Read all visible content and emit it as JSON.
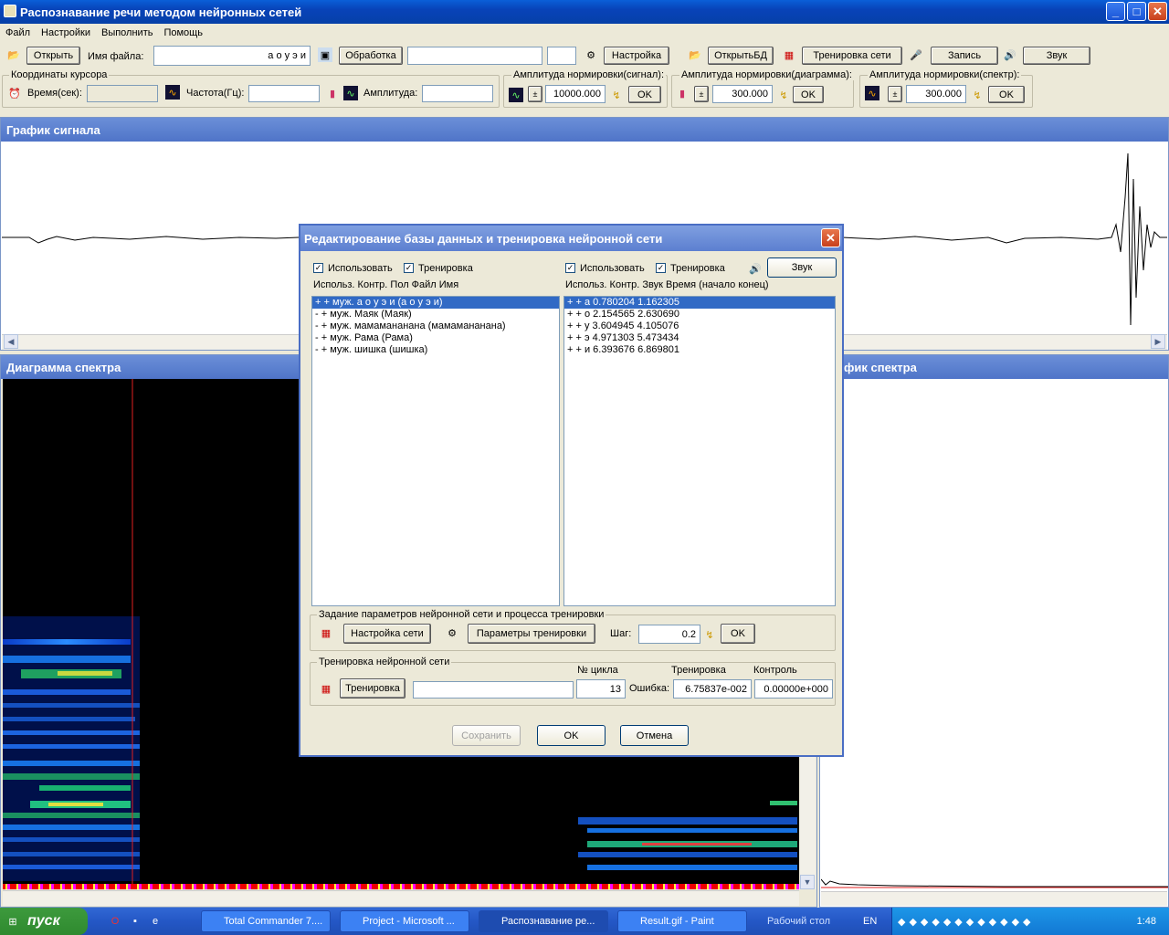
{
  "window": {
    "title": "Распознавание речи методом нейронных сетей"
  },
  "menu": [
    "Файл",
    "Настройки",
    "Выполнить",
    "Помощь"
  ],
  "toolbar": {
    "open": "Открыть",
    "filename_label": "Имя файла:",
    "filename_value": "а о у э и",
    "process": "Обработка",
    "settings": "Настройка",
    "open_db": "ОткрытьБД",
    "train_net": "Тренировка сети",
    "record": "Запись",
    "sound": "Звук"
  },
  "cursor": {
    "group": "Координаты курсора",
    "time_label": "Время(сек):",
    "freq_label": "Частота(Гц):",
    "amp_label": "Амплитуда:"
  },
  "amp_signal": {
    "group": "Амплитуда нормировки(сигнал):",
    "value": "10000.000",
    "ok": "OK"
  },
  "amp_diagram": {
    "group": "Амплитуда нормировки(диаграмма):",
    "value": "300.000",
    "ok": "OK"
  },
  "amp_spectrum": {
    "group": "Амплитуда нормировки(спектр):",
    "value": "300.000",
    "ok": "OK"
  },
  "panels": {
    "signal": "График сигнала",
    "diagram": "Диаграмма спектра",
    "spectrum": "График спектра",
    "spectrum_visible": "фик спектра"
  },
  "dialog": {
    "title": "Редактирование базы данных и тренировка нейронной сети",
    "use": "Использовать",
    "training": "Тренировка",
    "sound": "Звук",
    "left_header": "Использ. Контр. Пол Файл Имя",
    "right_header": "Использ. Контр. Звук Время (начало конец)",
    "left_items": [
      "+ + муж. а о у э и  (а о у э и)",
      "- + муж. Маяк  (Маяк)",
      "- + муж. мамамананана  (мамамананана)",
      "- + муж. Рама  (Рама)",
      "- + муж. шишка  (шишка)"
    ],
    "right_items": [
      "+ + а 0.780204 1.162305",
      "+ + о 2.154565 2.630690",
      "+ + у 3.604945 4.105076",
      "+ + э 4.971303 5.473434",
      "+ + и 6.393676 6.869801"
    ],
    "params_group": "Задание параметров нейронной сети и процесса тренировки",
    "net_settings": "Настройка сети",
    "train_params": "Параметры тренировки",
    "step_label": "Шаг:",
    "step_value": "0.2",
    "ok": "OK",
    "train_group": "Тренировка нейронной сети",
    "cycle_label": "№ цикла",
    "train_col": "Тренировка",
    "control_col": "Контроль",
    "train_btn": "Тренировка",
    "cycle_value": "13",
    "error_label": "Ошибка:",
    "train_error": "6.75837e-002",
    "control_error": "0.00000e+000",
    "save": "Сохранить",
    "cancel": "Отмена"
  },
  "taskbar": {
    "start": "пуск",
    "tasks": [
      "Total Commander 7....",
      "Project - Microsoft ...",
      "Распознавание ре...",
      "Result.gif - Paint"
    ],
    "desktop": "Рабочий стол",
    "lang": "EN",
    "clock": "1:48"
  }
}
